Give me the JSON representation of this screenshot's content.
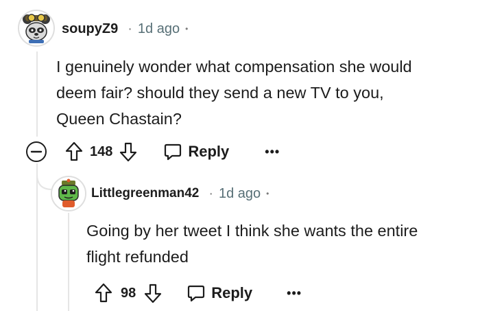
{
  "comments": [
    {
      "username": "soupyZ9",
      "separator": "·",
      "time": "1d ago",
      "trailing_dot": "•",
      "body_lines": [
        "I genuinely wonder what compensation she would",
        "deem fair? should they send a new TV to you,",
        "Queen Chastain?"
      ],
      "score": "148",
      "reply_label": "Reply",
      "more_label": "•••"
    },
    {
      "username": "Littlegreenman42",
      "separator": "·",
      "time": "1d ago",
      "trailing_dot": "•",
      "body_lines": [
        "Going by her tweet I think she wants the entire",
        "flight refunded"
      ],
      "score": "98",
      "reply_label": "Reply",
      "more_label": "•••"
    }
  ]
}
